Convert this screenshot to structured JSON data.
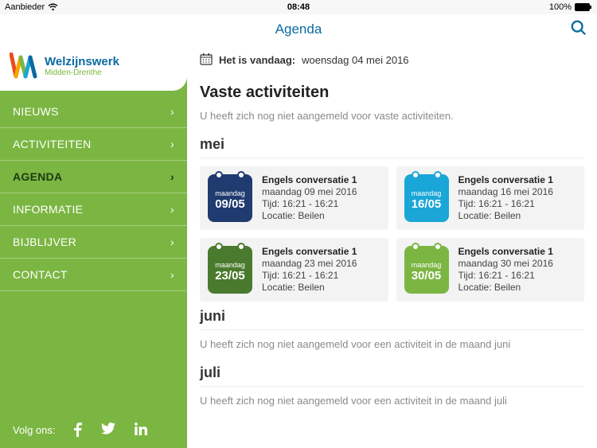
{
  "status": {
    "carrier": "Aanbieder",
    "time": "08:48",
    "battery": "100%"
  },
  "header": {
    "title": "Agenda"
  },
  "logo": {
    "line1": "Welzijnswerk",
    "line2": "Midden-Drenthe"
  },
  "nav": {
    "items": [
      {
        "label": "NIEUWS"
      },
      {
        "label": "ACTIVITEITEN"
      },
      {
        "label": "AGENDA"
      },
      {
        "label": "INFORMATIE"
      },
      {
        "label": "BIJBLIJVER"
      },
      {
        "label": "CONTACT"
      }
    ],
    "active_index": 2
  },
  "follow": {
    "label": "Volg ons:"
  },
  "today": {
    "label": "Het is vandaag:",
    "value": "woensdag 04 mei 2016"
  },
  "sections": {
    "vaste": {
      "heading": "Vaste activiteiten",
      "empty": "U heeft zich nog niet aangemeld voor vaste activiteiten."
    },
    "mei": {
      "heading": "mei",
      "events": [
        {
          "color": "navy",
          "dow": "maandag",
          "dd": "09/05",
          "title": "Engels conversatie 1",
          "date": "maandag 09 mei 2016",
          "time": "Tijd: 16:21 - 16:21",
          "loc": "Locatie: Beilen"
        },
        {
          "color": "cyan",
          "dow": "maandag",
          "dd": "16/05",
          "title": "Engels conversatie 1",
          "date": "maandag 16 mei 2016",
          "time": "Tijd: 16:21 - 16:21",
          "loc": "Locatie: Beilen"
        },
        {
          "color": "darkgreen",
          "dow": "maandag",
          "dd": "23/05",
          "title": "Engels conversatie 1",
          "date": "maandag 23 mei 2016",
          "time": "Tijd: 16:21 - 16:21",
          "loc": "Locatie: Beilen"
        },
        {
          "color": "green",
          "dow": "maandag",
          "dd": "30/05",
          "title": "Engels conversatie 1",
          "date": "maandag 30 mei 2016",
          "time": "Tijd: 16:21 - 16:21",
          "loc": "Locatie: Beilen"
        }
      ]
    },
    "juni": {
      "heading": "juni",
      "empty": "U heeft zich nog niet aangemeld voor een activiteit in de maand juni"
    },
    "juli": {
      "heading": "juli",
      "empty": "U heeft zich nog niet aangemeld voor een activiteit in de maand juli"
    }
  }
}
